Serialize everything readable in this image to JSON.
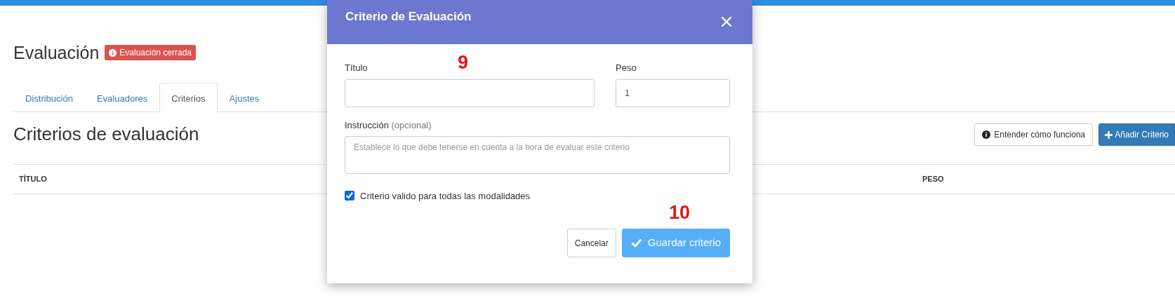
{
  "page": {
    "title": "Evaluación",
    "status_badge": "Evaluación cerrada"
  },
  "tabs": [
    {
      "label": "Distribución",
      "selected": false
    },
    {
      "label": "Evaluadores",
      "selected": false
    },
    {
      "label": "Criterios",
      "selected": true
    },
    {
      "label": "Ajustes",
      "selected": false
    }
  ],
  "section": {
    "title": "Criterios de evaluación",
    "buttons": [
      {
        "kind": "info",
        "label": "Entender cómo funciona"
      },
      {
        "kind": "add",
        "label": "Añadir Criterio"
      }
    ]
  },
  "table": {
    "columns": [
      "TÍTULO",
      "PESO"
    ]
  },
  "modal": {
    "title": "Criterio de Evaluación",
    "title_field": {
      "label": "Título"
    },
    "weight_field": {
      "label": "Peso",
      "value": "1"
    },
    "instruction_field": {
      "label": "Instrucción",
      "hint": "(opcional)",
      "placeholder": "Establece lo que debe tenerse en cuenta a la hora de evaluar este criterio"
    },
    "all_modes": {
      "label": "Criterio valido para todas las modalidades",
      "checked": true
    },
    "buttons": [
      {
        "kind": "cancel",
        "label": "Cancelar"
      },
      {
        "kind": "save",
        "label": "Guardar criterio"
      }
    ]
  },
  "annotations": [
    {
      "text": "9"
    },
    {
      "text": "10"
    }
  ]
}
